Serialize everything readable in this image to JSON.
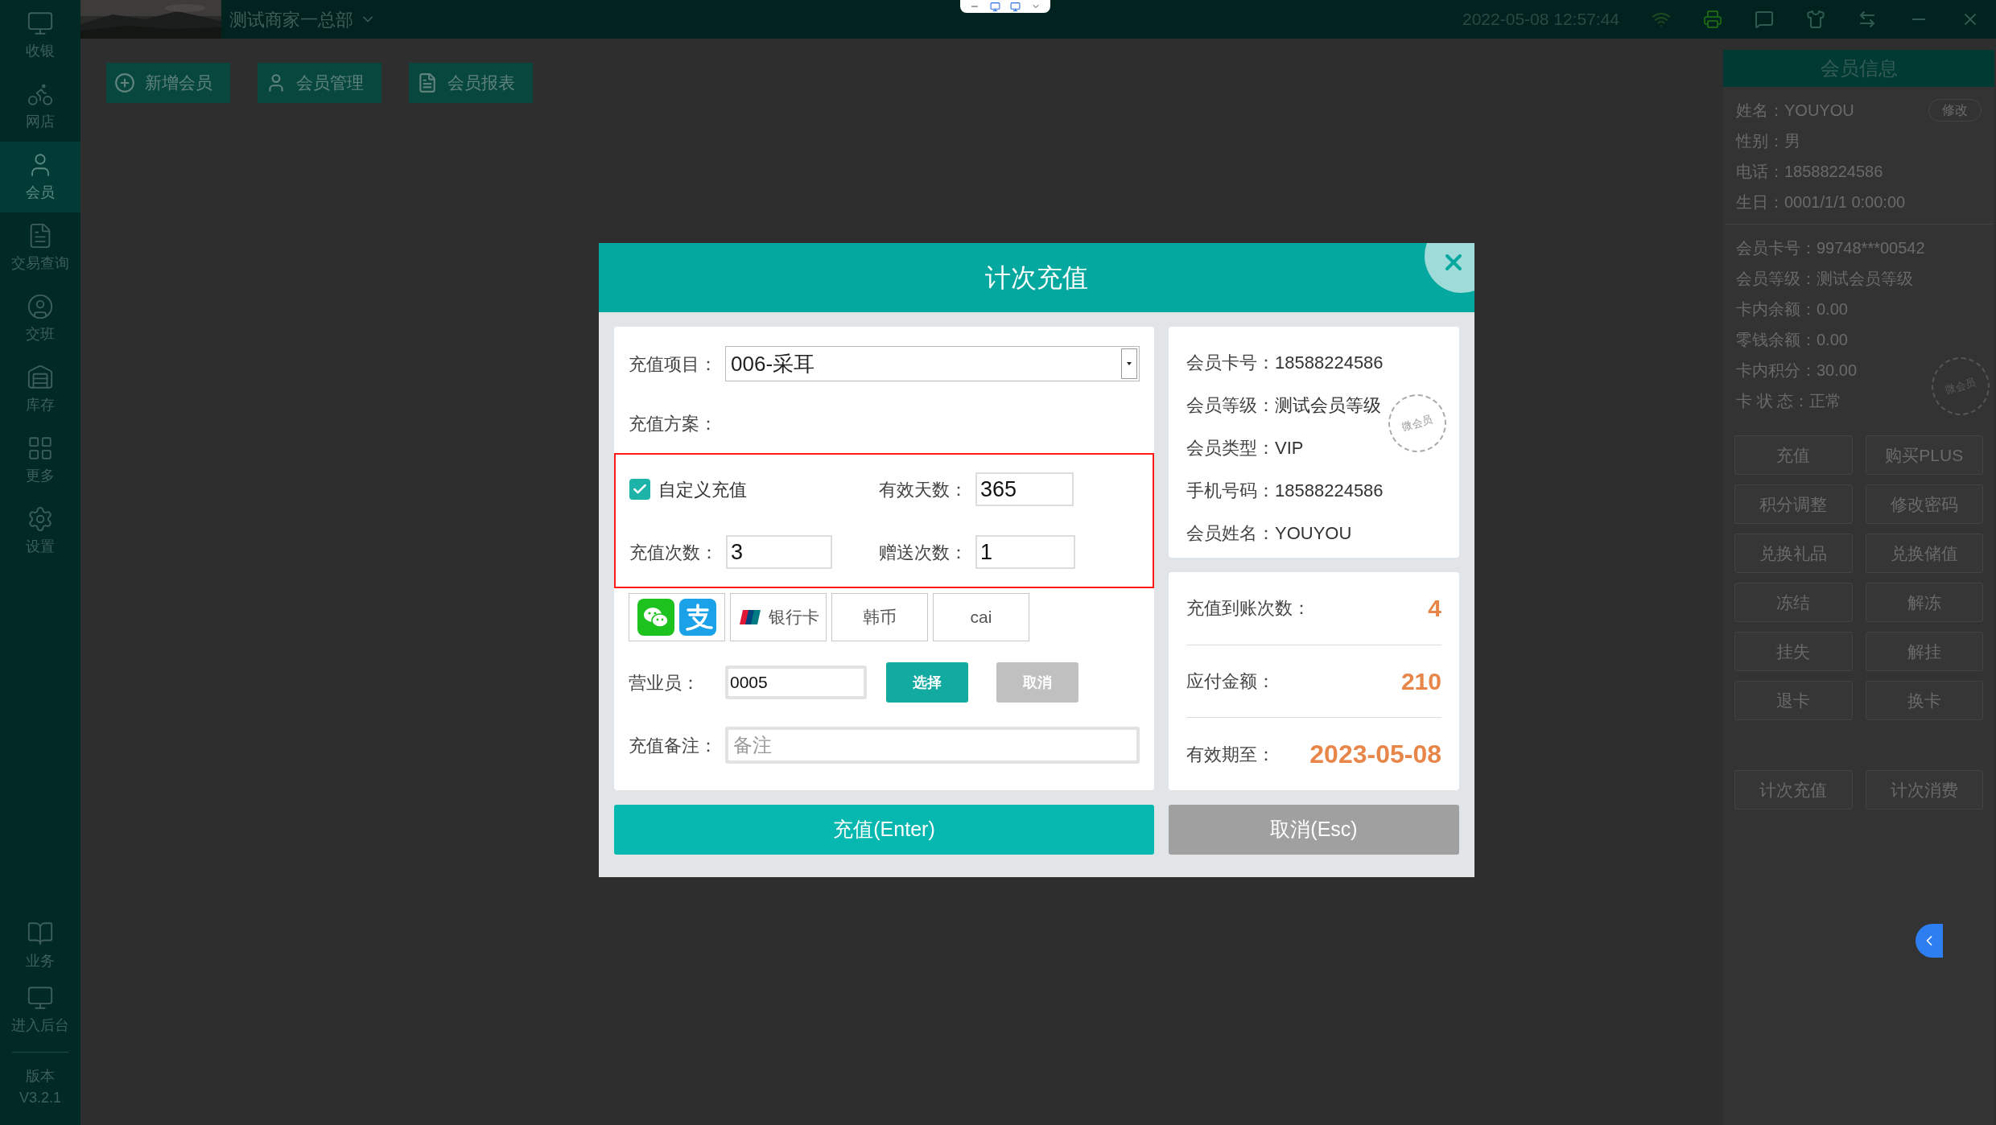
{
  "top_bar": {
    "store_name": "测试商家一总部",
    "datetime": "2022-05-08 12:57:44"
  },
  "sidebar": {
    "items": [
      {
        "label": "收银",
        "selected": false
      },
      {
        "label": "网店",
        "selected": false
      },
      {
        "label": "会员",
        "selected": true
      },
      {
        "label": "交易查询",
        "selected": false
      },
      {
        "label": "交班",
        "selected": false
      },
      {
        "label": "库存",
        "selected": false
      },
      {
        "label": "更多",
        "selected": false
      },
      {
        "label": "设置",
        "selected": false
      }
    ],
    "bottom_items": [
      {
        "label": "业务"
      },
      {
        "label": "进入后台"
      }
    ],
    "version": {
      "label": "版本",
      "value": "V3.2.1"
    }
  },
  "toolbar": [
    "新增会员",
    "会员管理",
    "会员报表"
  ],
  "member_panel": {
    "title": "会员信息",
    "edit_button": "修改",
    "personal": [
      {
        "label": "姓名：",
        "value": "YOUYOU"
      },
      {
        "label": "性别：",
        "value": "男"
      },
      {
        "label": "电话：",
        "value": "18588224586"
      },
      {
        "label": "生日：",
        "value": "0001/1/1 0:00:00"
      }
    ],
    "card": [
      {
        "label": "会员卡号：",
        "value": "99748***00542"
      },
      {
        "label": "会员等级：",
        "value": "测试会员等级"
      },
      {
        "label": "卡内余额：",
        "value": "0.00"
      },
      {
        "label": "零钱余额：",
        "value": "0.00"
      },
      {
        "label": "卡内积分：",
        "value": "30.00"
      },
      {
        "label": "卡 状 态：",
        "value": "正常"
      }
    ],
    "stamp": "微会员",
    "actions": [
      "充值",
      "购买PLUS",
      "积分调整",
      "修改密码",
      "兑换礼品",
      "兑换储值",
      "冻结",
      "解冻",
      "挂失",
      "解挂",
      "退卡",
      "换卡"
    ],
    "bottom_actions": [
      "计次充值",
      "计次消费"
    ]
  },
  "dialog": {
    "title": "计次充值",
    "item": {
      "label": "充值项目：",
      "value": "006-采耳"
    },
    "plan_label": "充值方案：",
    "custom": {
      "label": "自定义充值",
      "checked": true
    },
    "valid_days": {
      "label": "有效天数：",
      "value": "365"
    },
    "count": {
      "label": "充值次数：",
      "value": "3"
    },
    "bonus": {
      "label": "赠送次数：",
      "value": "1"
    },
    "payment_methods": [
      {
        "kind": "wechat"
      },
      {
        "kind": "alipay"
      },
      {
        "kind": "unionpay",
        "label": "银行卡"
      },
      {
        "kind": "text",
        "label": "韩币"
      },
      {
        "kind": "text",
        "label": "cai"
      }
    ],
    "staff": {
      "label": "营业员：",
      "value": "0005",
      "select_button": "选择",
      "cancel_button": "取消"
    },
    "note": {
      "label": "充值备注：",
      "placeholder": "备注"
    },
    "info": [
      {
        "label": "会员卡号：",
        "value": "18588224586"
      },
      {
        "label": "会员等级：",
        "value": "测试会员等级"
      },
      {
        "label": "会员类型：",
        "value": "VIP"
      },
      {
        "label": "手机号码：",
        "value": "18588224586"
      },
      {
        "label": "会员姓名：",
        "value": "YOUYOU"
      }
    ],
    "stamp": "微会员",
    "summary": [
      {
        "label": "充值到账次数：",
        "value": "4"
      },
      {
        "label": "应付金额：",
        "value": "210"
      },
      {
        "label": "有效期至：",
        "value": "2023-05-08"
      }
    ],
    "confirm_button": "充值(Enter)",
    "cancel_button": "取消(Esc)"
  }
}
